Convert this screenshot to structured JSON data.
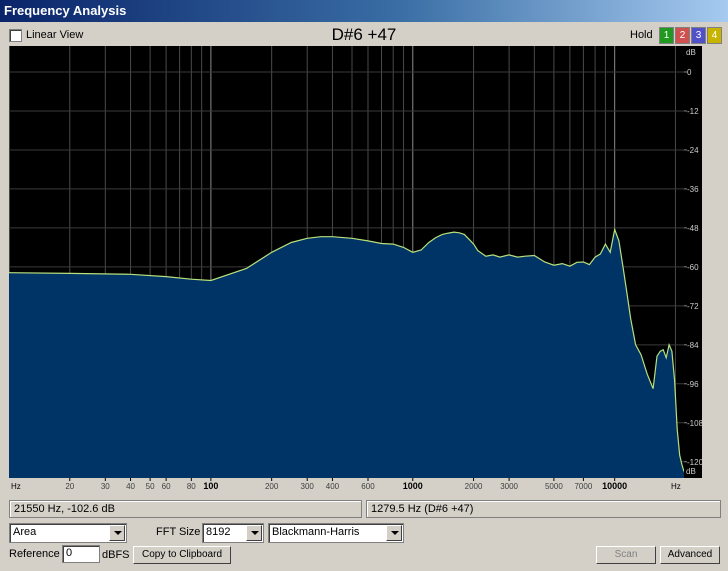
{
  "window": {
    "title": "Frequency Analysis"
  },
  "top": {
    "linear_view_label": "Linear View",
    "note_display": "D#6 +47",
    "hold_label": "Hold",
    "hold_buttons": [
      "1",
      "2",
      "3",
      "4"
    ],
    "hold_colors": [
      "#1f9a1f",
      "#d05050",
      "#5050c8",
      "#c8b400"
    ]
  },
  "status": {
    "cursor_readout": "21550 Hz, -102.6 dB",
    "peak_readout": "1279.5 Hz (D#6 +47)"
  },
  "controls": {
    "display_mode": "Area",
    "fft_size_label": "FFT Size",
    "fft_size": "8192",
    "window_type": "Blackmann-Harris",
    "reference_label": "Reference",
    "reference_value": "0",
    "reference_unit": "dBFS",
    "copy_button": "Copy to Clipboard",
    "scan_button": "Scan",
    "advanced_button": "Advanced"
  },
  "chart_data": {
    "type": "area",
    "x_scale": "log",
    "x_unit_label": "Hz",
    "y_unit_label": "dB",
    "x_ticks": [
      "20",
      "30",
      "40",
      "50",
      "60",
      "80",
      "100",
      "200",
      "300",
      "400",
      "600",
      "1000",
      "2000",
      "3000",
      "5000",
      "7000",
      "10000"
    ],
    "y_ticks": [
      "0",
      "-12",
      "-24",
      "-36",
      "-48",
      "-60",
      "-72",
      "-84",
      "-96",
      "-108",
      "-120"
    ],
    "xlim": [
      10,
      22050
    ],
    "ylim": [
      -125,
      8
    ],
    "fill_color": "#003366",
    "line_color": "#b8e07a",
    "grid": true,
    "x": [
      10,
      20,
      40,
      60,
      80,
      100,
      150,
      200,
      250,
      300,
      350,
      400,
      500,
      600,
      700,
      800,
      900,
      1000,
      1100,
      1200,
      1300,
      1400,
      1500,
      1600,
      1700,
      1800,
      1900,
      2000,
      2100,
      2300,
      2500,
      2700,
      3000,
      3300,
      3600,
      4000,
      4500,
      5000,
      5500,
      6000,
      6500,
      7000,
      7500,
      8000,
      8500,
      9000,
      9500,
      10000,
      10500,
      11000,
      11500,
      12000,
      12700,
      13500,
      14500,
      15500,
      16200,
      16800,
      17400,
      18000,
      18600,
      19200,
      19800,
      20400,
      21000,
      21550,
      22050
    ],
    "y": [
      -61.8,
      -62,
      -62.3,
      -63,
      -63.8,
      -64.2,
      -60.5,
      -55.5,
      -52.5,
      -51.2,
      -50.7,
      -50.7,
      -51.2,
      -52,
      -52.8,
      -53,
      -54,
      -55.5,
      -54.8,
      -52.5,
      -51,
      -50,
      -49.6,
      -49.3,
      -49.5,
      -50,
      -51.5,
      -53,
      -55,
      -56.7,
      -56.3,
      -57,
      -56.3,
      -57,
      -56.7,
      -56.5,
      -58.5,
      -59.5,
      -59,
      -59.8,
      -58.6,
      -58.5,
      -59.3,
      -57,
      -56,
      -53,
      -55.5,
      -48.5,
      -52,
      -60,
      -68,
      -76,
      -84,
      -87,
      -93,
      -97.5,
      -87.5,
      -86,
      -85.5,
      -88,
      -84,
      -86,
      -95,
      -110,
      -118,
      -121,
      -123
    ]
  }
}
